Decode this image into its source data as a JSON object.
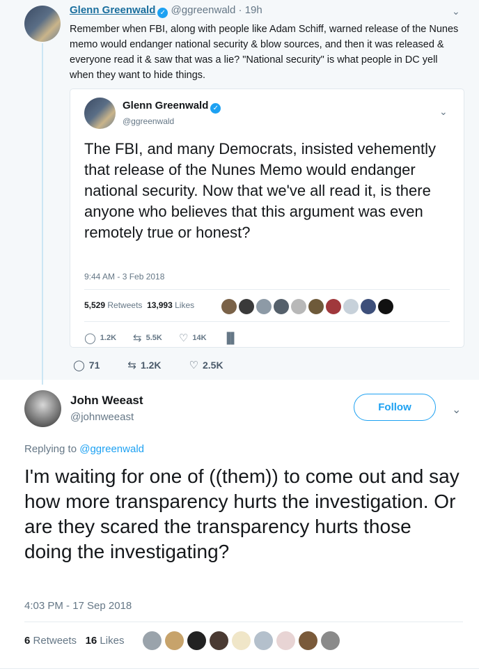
{
  "parent_tweet": {
    "name": "Glenn Greenwald",
    "handle": "@ggreenwald",
    "time": "19h",
    "text": "Remember when FBI, along with people like Adam Schiff, warned release of the Nunes memo would endanger national security & blow sources, and then it was released & everyone read it & saw that was a lie? \"National security\" is what people in DC yell when they want to hide things.",
    "quoted": {
      "name": "Glenn Greenwald",
      "handle": "@ggreenwald",
      "text": "The FBI, and many Democrats, insisted vehemently that release of the Nunes Memo would endanger national security. Now that we've all read it, is there anyone who believes that this argument was even remotely true or honest?",
      "timestamp": "9:44 AM - 3 Feb 2018",
      "retweets_count": "5,529",
      "retweets_label": "Retweets",
      "likes_count": "13,993",
      "likes_label": "Likes",
      "replies": "1.2K",
      "retweets_short": "5.5K",
      "likes_short": "14K"
    },
    "actions": {
      "replies": "71",
      "retweets": "1.2K",
      "likes": "2.5K"
    }
  },
  "main_tweet": {
    "name": "John Weeast",
    "handle": "@johnweeast",
    "follow_label": "Follow",
    "replying_prefix": "Replying to",
    "replying_handle": "@ggreenwald",
    "text": "I'm waiting for one of ((them)) to come out and say how more transparency hurts the investigation. Or are they scared the transparency hurts those doing the investigating?",
    "timestamp": "4:03 PM - 17 Sep 2018",
    "retweets_count": "6",
    "retweets_label": "Retweets",
    "likes_count": "16",
    "likes_label": "Likes"
  },
  "colors": {
    "accent": "#1da1f2",
    "link": "#1b6f9e",
    "muted": "#657786",
    "parent_bg": "#f5f8fa"
  },
  "icons": [
    "verified-badge-icon",
    "chevron-down-icon",
    "reply-icon",
    "retweet-icon",
    "like-icon",
    "analytics-icon"
  ]
}
